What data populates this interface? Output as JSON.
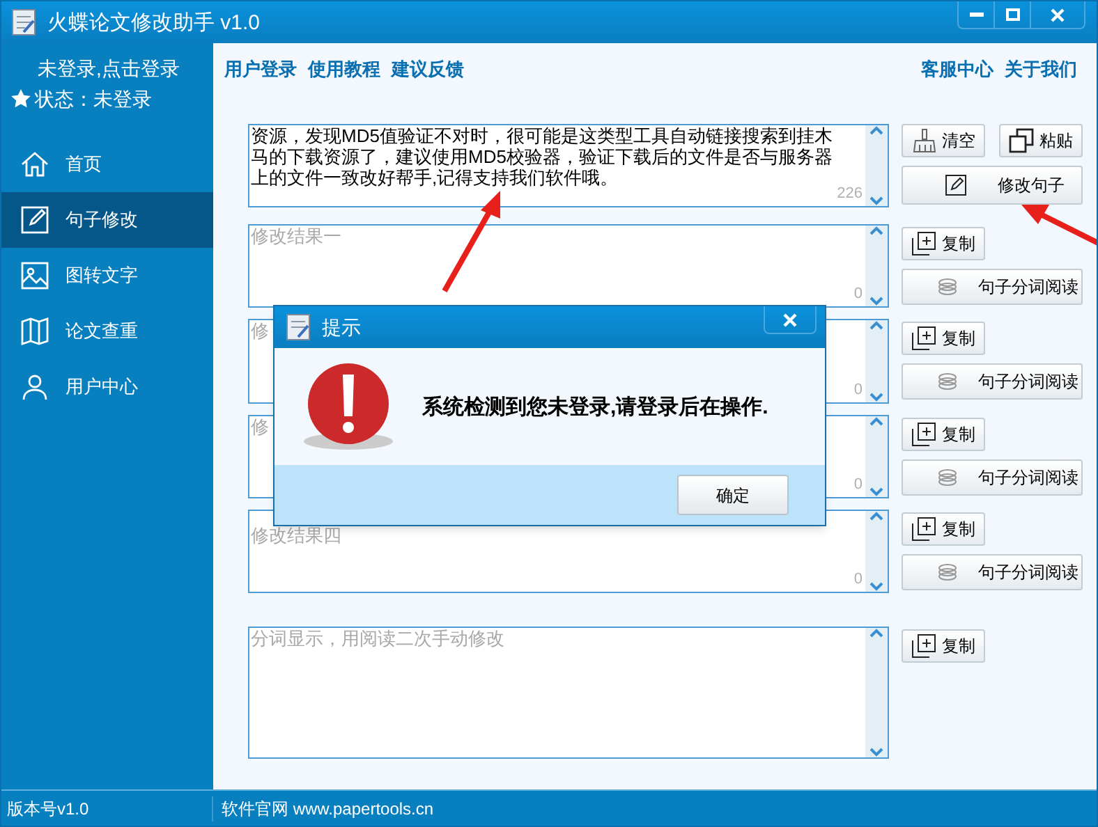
{
  "window": {
    "title": "火蝶论文修改助手 v1.0"
  },
  "user_panel": {
    "login_link": "未登录,点击登录",
    "status": "状态：未登录"
  },
  "top_links": [
    "用户登录",
    "使用教程",
    "建议反馈"
  ],
  "right_links": [
    "客服中心",
    "关于我们"
  ],
  "sidebar": {
    "items": [
      {
        "label": "首页",
        "selected": false
      },
      {
        "label": "句子修改",
        "selected": true
      },
      {
        "label": "图转文字",
        "selected": false
      },
      {
        "label": "论文查重",
        "selected": false
      },
      {
        "label": "用户中心",
        "selected": false
      }
    ]
  },
  "input": {
    "value": "资源，发现MD5值验证不对时，很可能是这类型工具自动链接搜索到挂木马的下载资源了，建议使用MD5校验器，验证下载后的文件是否与服务器上的文件一致改好帮手,记得支持我们软件哦。",
    "count": "226",
    "buttons": [
      "清空",
      "粘贴"
    ],
    "action": "修改句子"
  },
  "results": [
    {
      "placeholder": "修改结果一",
      "count": "0",
      "copy": "复制",
      "read": "句子分词阅读"
    },
    {
      "placeholder": "修",
      "count": "0",
      "copy": "复制",
      "read": "句子分词阅读"
    },
    {
      "placeholder": "修",
      "count": "0",
      "copy": "复制",
      "read": "句子分词阅读"
    },
    {
      "placeholder": "修改结果四",
      "count": "0",
      "copy": "复制",
      "read": "句子分词阅读"
    }
  ],
  "segments": {
    "placeholder": "分词显示，用阅读二次手动修改",
    "copy": "复制"
  },
  "dialog": {
    "title": "提示",
    "message": "系统检测到您未登录,请登录后在操作.",
    "ok": "确定"
  },
  "status_bar": {
    "version": "版本号v1.0",
    "website": "软件官网 www.papertools.cn"
  }
}
